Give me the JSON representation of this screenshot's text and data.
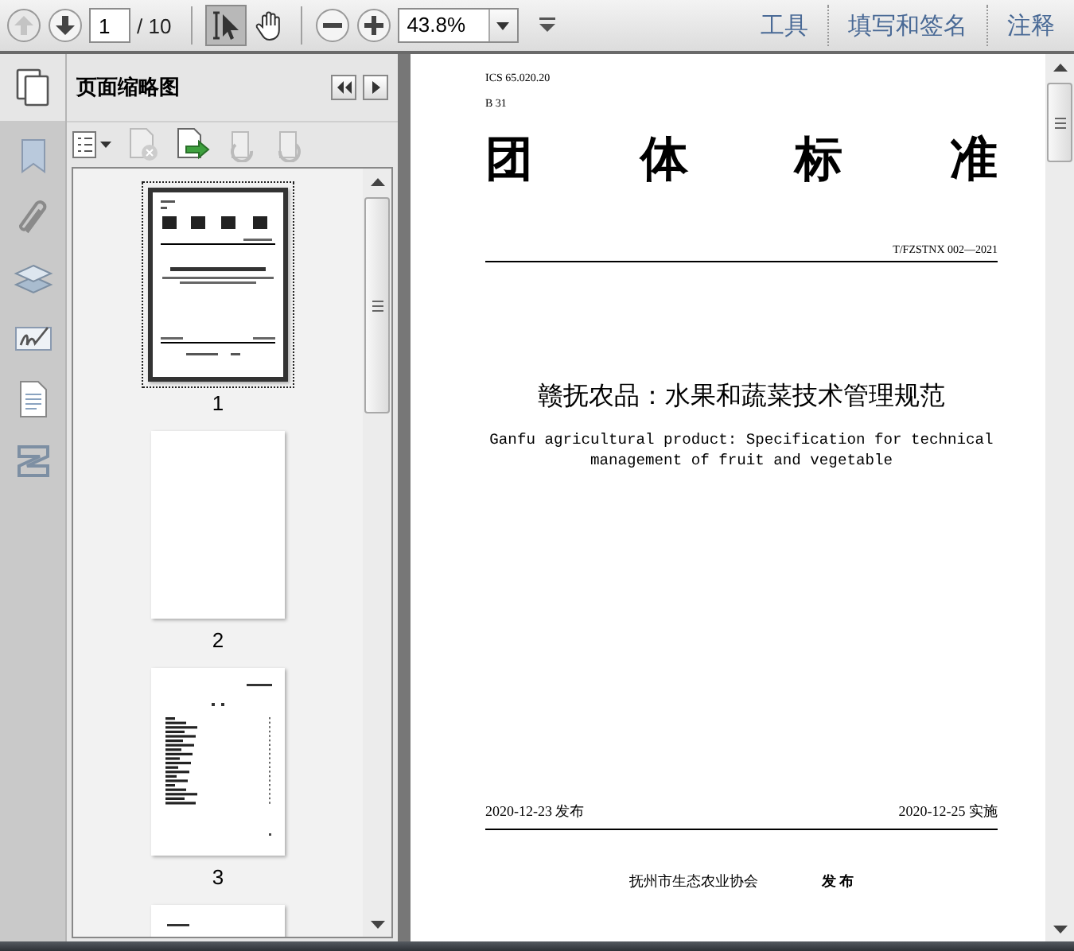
{
  "toolbar": {
    "page_number": "1",
    "page_count": "/ 10",
    "zoom": "43.8%",
    "select_tool_selected": true,
    "menu_links": [
      "工具",
      "填写和签名",
      "注释"
    ]
  },
  "sidebar": {
    "title": "页面缩略图"
  },
  "thumbnails": [
    {
      "label": "1",
      "selected": true,
      "kind": "cover"
    },
    {
      "label": "2",
      "selected": false,
      "kind": "blank"
    },
    {
      "label": "3",
      "selected": false,
      "kind": "contents"
    },
    {
      "selected": false,
      "kind": "heading"
    }
  ],
  "document": {
    "ics": "ICS 65.020.20",
    "ccs": "B 31",
    "heading": "团 体 标 准",
    "code": "T/FZSTNX 002—2021",
    "title_cn": "赣抚农品：水果和蔬菜技术管理规范",
    "title_en": "Ganfu agricultural product: Specification for technical management of fruit and vegetable",
    "release_date": "2020-12-23 发布",
    "effective_date": "2020-12-25 实施",
    "publisher": "抚州市生态农业协会",
    "publish_word": "发 布"
  }
}
